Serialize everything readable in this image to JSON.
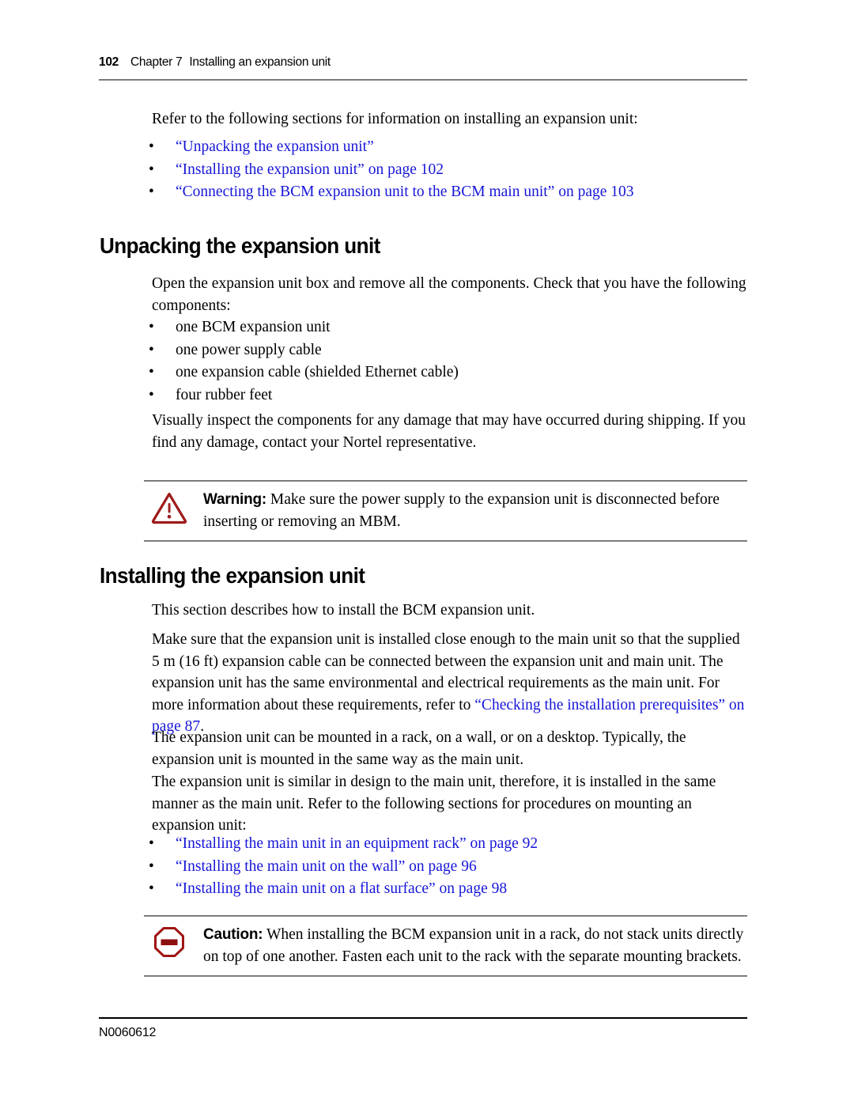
{
  "header": {
    "page_number": "102",
    "chapter_label": "Chapter 7",
    "chapter_title": "Installing an expansion unit"
  },
  "footer": {
    "doc_number": "N0060612"
  },
  "intro": {
    "paragraph": "Refer to the following sections for information on installing an expansion unit:",
    "links": [
      "“Unpacking the expansion unit”",
      "“Installing the expansion unit” on page 102",
      "“Connecting the BCM expansion unit to the BCM main unit” on page 103"
    ]
  },
  "section_unpacking": {
    "heading": "Unpacking the expansion unit",
    "intro": "Open the expansion unit box and remove all the components. Check that you have the following components:",
    "components": [
      "one BCM expansion unit",
      "one power supply cable",
      "one expansion cable (shielded Ethernet cable)",
      "four rubber feet"
    ],
    "inspect": "Visually inspect the components for any damage that may have occurred during shipping. If you find any damage, contact your Nortel representative.",
    "warning": {
      "label": "Warning:",
      "text": " Make sure the power supply to the expansion unit is disconnected before inserting or removing an MBM.",
      "icon": "warning-triangle-icon",
      "color": "#9e1b1b"
    }
  },
  "section_installing": {
    "heading": "Installing the expansion unit",
    "para1": "This section describes how to install the BCM expansion unit.",
    "para2_a": "Make sure that the expansion unit is installed close enough to the main unit so that the supplied 5 m (16 ft) expansion cable can be connected between the expansion unit and main unit. The expansion unit has the same environmental and electrical requirements as the main unit. For more information about these requirements, refer to ",
    "para2_link": "“Checking the installation prerequisites” on page 87",
    "para2_b": ".",
    "para3": "The expansion unit can be mounted in a rack, on a wall, or on a desktop. Typically, the expansion unit is mounted in the same way as the main unit.",
    "para4": "The expansion unit is similar in design to the main unit, therefore, it is installed in the same manner as the main unit. Refer to the following sections for procedures on mounting an expansion unit:",
    "links": [
      "“Installing the main unit in an equipment rack” on page 92",
      "“Installing the main unit on the wall” on page 96",
      "“Installing the main unit on a flat surface” on page 98"
    ],
    "caution": {
      "label": "Caution:",
      "text": " When installing the BCM expansion unit in a rack, do not stack units directly on top of one another. Fasten each unit to the rack with the separate mounting brackets.",
      "icon": "caution-octagon-icon",
      "color": "#a01414"
    }
  },
  "colors": {
    "link": "#1616d8",
    "rule": "#8c8c8c",
    "text": "#000000"
  },
  "bullet_glyph": "•"
}
